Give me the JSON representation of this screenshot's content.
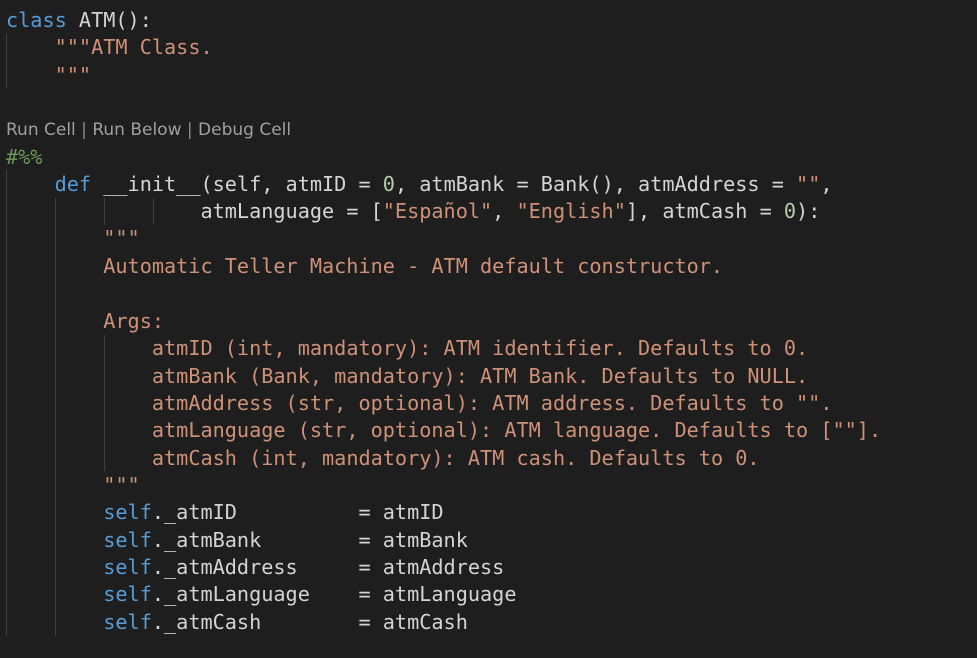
{
  "editor": {
    "lines": {
      "l1": {
        "kw": "class",
        "name": " ATM",
        "rest": "():"
      },
      "l2": {
        "doc": "\"\"\"ATM Class."
      },
      "l3": {
        "doc": "\"\"\""
      },
      "l5": {
        "comment": "#%%"
      },
      "l6": {
        "kw": "def",
        "p1": " __init__(self, atmID = ",
        "n1": "0",
        "p2": ", atmBank = Bank(), atmAddress = ",
        "s1": "\"\"",
        "p3": ","
      },
      "l7": {
        "p1": "atmLanguage = [",
        "s1": "\"Español\"",
        "p2": ", ",
        "s2": "\"English\"",
        "p3": "], atmCash = ",
        "n1": "0",
        "p4": "):"
      },
      "l8": {
        "doc": "\"\"\""
      },
      "l9": {
        "doc": "Automatic Teller Machine - ATM default constructor."
      },
      "l11": {
        "doc": "Args:"
      },
      "l12": {
        "doc": "atmID (int, mandatory): ATM identifier. Defaults to 0."
      },
      "l13": {
        "doc": "atmBank (Bank, mandatory): ATM Bank. Defaults to NULL."
      },
      "l14": {
        "doc": "atmAddress (str, optional): ATM address. Defaults to \"\"."
      },
      "l15": {
        "doc": "atmLanguage (str, optional): ATM language. Defaults to [\"\"]."
      },
      "l16": {
        "doc": "atmCash (int, mandatory): ATM cash. Defaults to 0."
      },
      "l17": {
        "doc": "\"\"\""
      },
      "l18": {
        "self": "self",
        "rest": "._atmID          = atmID"
      },
      "l19": {
        "self": "self",
        "rest": "._atmBank        = atmBank"
      },
      "l20": {
        "self": "self",
        "rest": "._atmAddress     = atmAddress"
      },
      "l21": {
        "self": "self",
        "rest": "._atmLanguage    = atmLanguage"
      },
      "l22": {
        "self": "self",
        "rest": "._atmCash        = atmCash"
      }
    },
    "codelens": {
      "run_cell": "Run Cell",
      "run_below": "Run Below",
      "debug_cell": "Debug Cell",
      "separator": " | "
    },
    "colors": {
      "background": "#1e1e1e",
      "keyword": "#569cd6",
      "string": "#ce9178",
      "number": "#b5cea8",
      "comment": "#6a9955",
      "text": "#d4d4d4",
      "codelens": "#a0a0a0"
    }
  }
}
